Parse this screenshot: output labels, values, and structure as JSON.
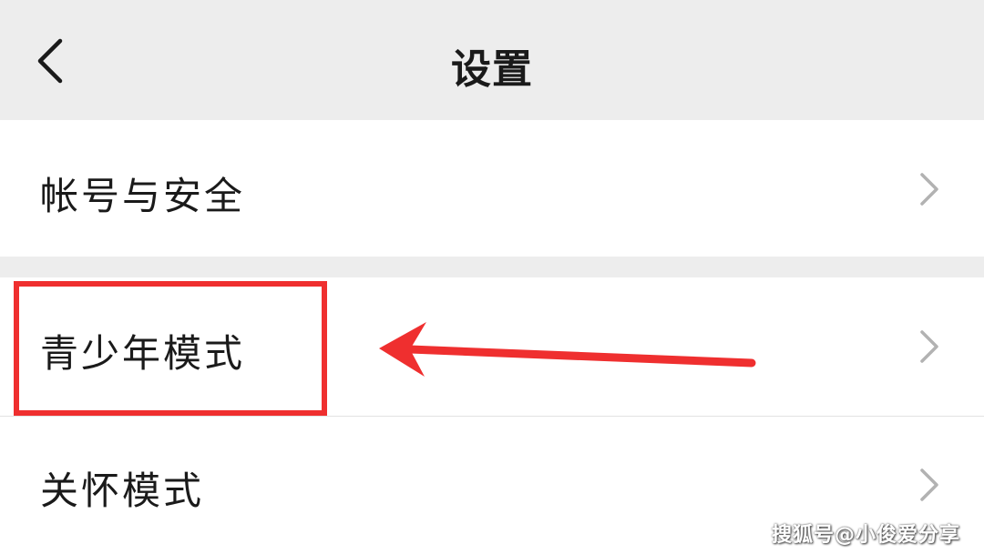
{
  "header": {
    "title": "设置",
    "back_icon": "chevron-left-icon"
  },
  "settings_items": [
    {
      "label": "帐号与安全",
      "chevron_icon": "chevron-right-icon"
    },
    {
      "label": "青少年模式",
      "chevron_icon": "chevron-right-icon"
    },
    {
      "label": "关怀模式",
      "chevron_icon": "chevron-right-icon"
    }
  ],
  "annotation": {
    "color": "#ef2f2f",
    "target": "青少年模式"
  },
  "watermark": "搜狐号@小俊爱分享",
  "colors": {
    "background": "#ededed",
    "row_background": "#ffffff",
    "text": "#1a1a1a",
    "chevron": "#b2b2b2"
  }
}
